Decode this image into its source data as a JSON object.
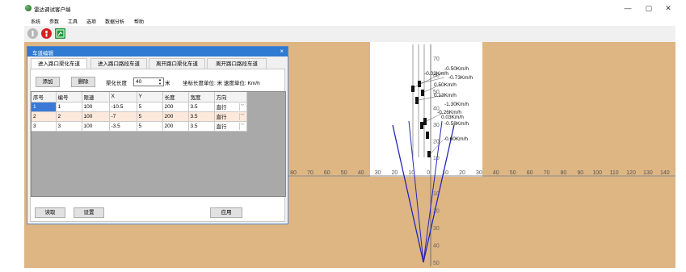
{
  "window": {
    "title": "雷达调试客户端",
    "minimize": "—",
    "maximize": "▢",
    "close": "✕"
  },
  "menu": [
    "系统",
    "参数",
    "工具",
    "选项",
    "数据分析",
    "帮助"
  ],
  "toolbar": {
    "icons": [
      "info-icon",
      "traffic-light-icon",
      "exit-icon"
    ]
  },
  "dialog": {
    "title": "车道编辑",
    "close": "×",
    "tabs": [
      "进入路口渠化车道",
      "进入路口路段车道",
      "离开路口渠化车道",
      "离开路口路段车道"
    ],
    "add_label": "添加",
    "delete_label": "删除",
    "length_label": "渠化长度",
    "length_value": "40",
    "length_unit": "米",
    "units_text": "坐标长度单位: 米  速度单位: Km/h",
    "read_label": "读取",
    "settings_label": "设置",
    "apply_label": "应用",
    "table": {
      "headers": [
        "序号",
        "编号",
        "限速",
        "X",
        "Y",
        "长度",
        "宽度",
        "方向"
      ],
      "rows": [
        [
          "1",
          "1",
          "100",
          "-10.5",
          "5",
          "200",
          "3.5",
          "直行"
        ],
        [
          "2",
          "2",
          "100",
          "-7",
          "5",
          "200",
          "3.5",
          "直行"
        ],
        [
          "3",
          "3",
          "100",
          "-3.5",
          "5",
          "200",
          "3.5",
          "直行"
        ]
      ]
    }
  },
  "radar": {
    "x_axis_ticks": [
      "80",
      "70",
      "60",
      "50",
      "40",
      "30",
      "20",
      "10",
      "0",
      "10",
      "20",
      "30",
      "40",
      "50",
      "60",
      "70",
      "80",
      "90",
      "100",
      "110",
      "120",
      "130",
      "140"
    ],
    "y_axis_ticks_up": [
      "70",
      "60",
      "50",
      "40",
      "30",
      "20",
      "10"
    ],
    "y_axis_ticks_down": [
      "10",
      "20",
      "30",
      "40",
      "50"
    ],
    "speed_labels": [
      "-0.50Km/h",
      "-0.03Km/h",
      "-0.73Km/h",
      "0.50Km/h",
      "0.13Km/h",
      "-1.30Km/h",
      "-0.26Km/h",
      "0.03Km/h",
      "-0.58Km/h",
      "-0.60Km/h"
    ],
    "colors": {
      "background": "#deb683",
      "panel": "#ffffff",
      "beam": "#2626b8",
      "axis": "#5a5a5a"
    }
  }
}
